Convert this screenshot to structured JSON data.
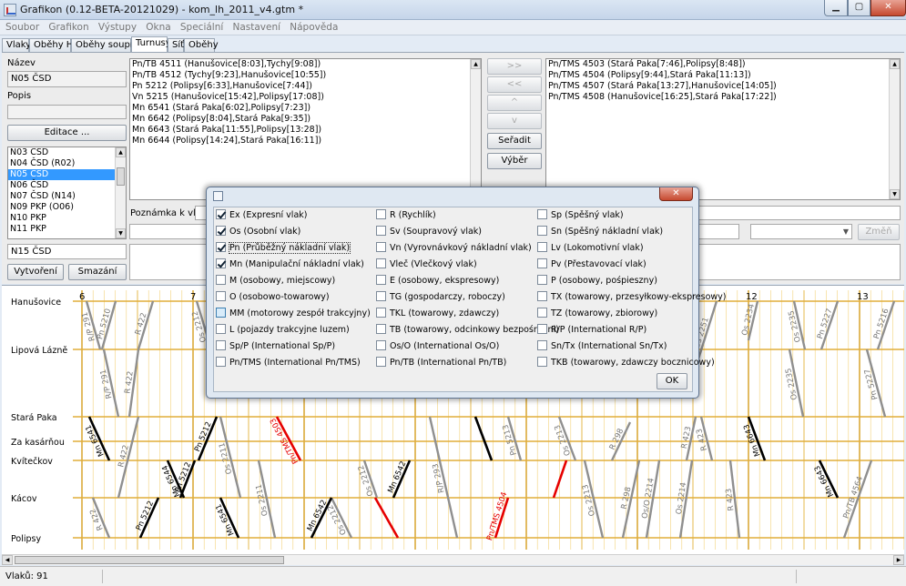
{
  "window": {
    "title": "Grafikon (0.12-BETA-20121029) - kom_lh_2011_v4.gtm *"
  },
  "menu": [
    "Soubor",
    "Grafikon",
    "Výstupy",
    "Okna",
    "Speciální",
    "Nastavení",
    "Nápověda"
  ],
  "tabs": [
    {
      "label": "Vlaky",
      "active": false
    },
    {
      "label": "Oběhy HV",
      "active": false
    },
    {
      "label": "Oběhy souprav",
      "active": false
    },
    {
      "label": "Turnusy",
      "active": true
    },
    {
      "label": "Síť",
      "active": false
    },
    {
      "label": "Oběhy",
      "active": false
    }
  ],
  "left": {
    "name_label": "Název",
    "name_value": "N05 ČSD",
    "desc_label": "Popis",
    "desc_value": "",
    "edit_button": "Editace ...",
    "crews": [
      "N03 ČSD",
      "N04 ČSD (R02)",
      "N05 ČSD",
      "N06 ČSD",
      "N07 ČSD (N14)",
      "N09 PKP (O06)",
      "N10 PKP",
      "N11 PKP"
    ],
    "selected_crew": "N05 ČSD",
    "new_name": "N15 ČSD",
    "create_button": "Vytvoření",
    "delete_button": "Smazání"
  },
  "trains_list": [
    "Pn/TB 4511 (Hanušovice[8:03],Tychy[9:08])",
    "Pn/TB 4512 (Tychy[9:23],Hanušovice[10:55])",
    "Pn 5212 (Polipsy[6:33],Hanušovice[7:44])",
    "Vn 5215 (Hanušovice[15:42],Polipsy[17:08])",
    "Mn 6541 (Stará Paka[6:02],Polipsy[7:23])",
    "Mn 6642 (Polipsy[8:04],Stará Paka[9:35])",
    "Mn 6643 (Stará Paka[11:55],Polipsy[13:28])",
    "Mn 6644 (Polipsy[14:24],Stará Paka[16:11])"
  ],
  "middle_buttons": {
    "add_all": ">>",
    "remove_all": "<<",
    "up": "^",
    "down": "v",
    "sort": "Seřadit",
    "select": "Výběr"
  },
  "assigned_list": [
    "Pn/TMS 4503 (Stará Paka[7:46],Polipsy[8:48])",
    "Pn/TMS 4504 (Polipsy[9:44],Stará Paka[11:13])",
    "Pn/TMS 4507 (Stará Paka[13:27],Hanušovice[14:05])",
    "Pn/TMS 4508 (Hanušovice[16:25],Stará Paka[17:22])"
  ],
  "note_label": "Poznámka k vlaku:",
  "change_button": "Změň",
  "graph": {
    "stations": [
      "Hanušovice",
      "Lipová Lázně",
      "Stará Paka",
      "Za kasárňou",
      "Kvítečkov",
      "Kácov",
      "Polipsy"
    ],
    "hours": [
      "6",
      "7",
      "12",
      "13"
    ],
    "black_labels": [
      "Mn 6541",
      "Pn 5212",
      "Mn 6542",
      "Mn 6643",
      "Mn 6544",
      "Pn 5212",
      "Pn 5212",
      "Mn 6541",
      "Mn 6542",
      "Mn 6643"
    ],
    "gray_labels": [
      "R/P 291",
      "Pn 5210",
      "R 422",
      "Os 2212",
      "R 422",
      "R/P 291",
      "R 422",
      "Os 2211",
      "R 422",
      "Os 2211",
      "Os 2212",
      "Os 2212",
      "R/P 293",
      "Pn 5213",
      "Os 2213",
      "R 298",
      "Os 2213",
      "R 298",
      "Os 2251",
      "Os 2234",
      "Os 2235",
      "Pn 5227",
      "Pn 5216",
      "R 423",
      "Os 2214",
      "R 423",
      "Pn 5227",
      "Pn/TB 4564",
      "R 423",
      "Os/O 2214",
      "Os 2235"
    ],
    "red_labels": [
      "Pn/TMS 4503",
      "Pn/TMS 4504"
    ]
  },
  "status": {
    "text": "Vlaků: 91"
  },
  "dialog": {
    "close_label": "✕",
    "ok_label": "OK",
    "columns": [
      [
        {
          "label": "Ex (Expresní vlak)",
          "checked": true
        },
        {
          "label": "Os (Osobní vlak)",
          "checked": true
        },
        {
          "label": "Pn (Průběžný nákladní vlak)",
          "checked": true
        },
        {
          "label": "Mn (Manipulační nákladní vlak)",
          "checked": true
        },
        {
          "label": "M (osobowy, miejscowy)",
          "checked": false
        },
        {
          "label": "O (osobowo-towarowy)",
          "checked": false
        },
        {
          "label": "MM (motorowy zespół trakcyjny)",
          "checked": false
        },
        {
          "label": "L (pojazdy trakcyjne luzem)",
          "checked": false
        },
        {
          "label": "Sp/P (International Sp/P)",
          "checked": false
        },
        {
          "label": "Pn/TMS (International Pn/TMS)",
          "checked": false
        }
      ],
      [
        {
          "label": "R (Rychlík)",
          "checked": false
        },
        {
          "label": "Sv (Soupravový vlak)",
          "checked": false
        },
        {
          "label": "Vn (Vyrovnávkový nákladní vlak)",
          "checked": false
        },
        {
          "label": "Vleč (Vlečkový vlak)",
          "checked": false
        },
        {
          "label": "E (osobowy, ekspresowy)",
          "checked": false
        },
        {
          "label": "TG (gospodarczy, roboczy)",
          "checked": false
        },
        {
          "label": "TKL (towarowy, zdawczy)",
          "checked": false
        },
        {
          "label": "TB (towarowy, odcinkowy bezpośredni)",
          "checked": false
        },
        {
          "label": "Os/O (International Os/O)",
          "checked": false
        },
        {
          "label": "Pn/TB (International Pn/TB)",
          "checked": false
        }
      ],
      [
        {
          "label": "Sp (Spěšný vlak)",
          "checked": false
        },
        {
          "label": "Sn (Spěšný nákladní vlak)",
          "checked": false
        },
        {
          "label": "Lv (Lokomotivní vlak)",
          "checked": false
        },
        {
          "label": "Pv (Přestavovací vlak)",
          "checked": false
        },
        {
          "label": "P (osobowy, pośpieszny)",
          "checked": false
        },
        {
          "label": "TX (towarowy, przesyłkowy-ekspresowy)",
          "checked": false
        },
        {
          "label": "TZ (towarowy, zbiorowy)",
          "checked": false
        },
        {
          "label": "R/P (International R/P)",
          "checked": false
        },
        {
          "label": "Sn/Tx (International Sn/Tx)",
          "checked": false
        },
        {
          "label": "TKB (towarowy, zdawczy bocznicowy)",
          "checked": false
        }
      ]
    ]
  }
}
